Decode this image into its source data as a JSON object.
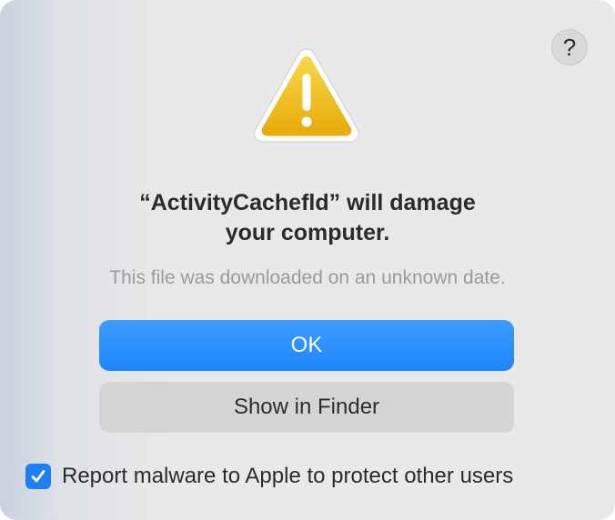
{
  "dialog": {
    "help_label": "?",
    "icon": "warning-triangle-icon",
    "title_line1": "“ActivityCachefld” will damage",
    "title_line2": "your computer.",
    "message": "This file was downloaded on an unknown date.",
    "ok_label": "OK",
    "show_in_finder_label": "Show in Finder",
    "report_checkbox": {
      "label": "Report malware to Apple to protect other users",
      "checked": true
    }
  },
  "colors": {
    "accent": "#1e86fb",
    "warning": "#f5c20c"
  }
}
